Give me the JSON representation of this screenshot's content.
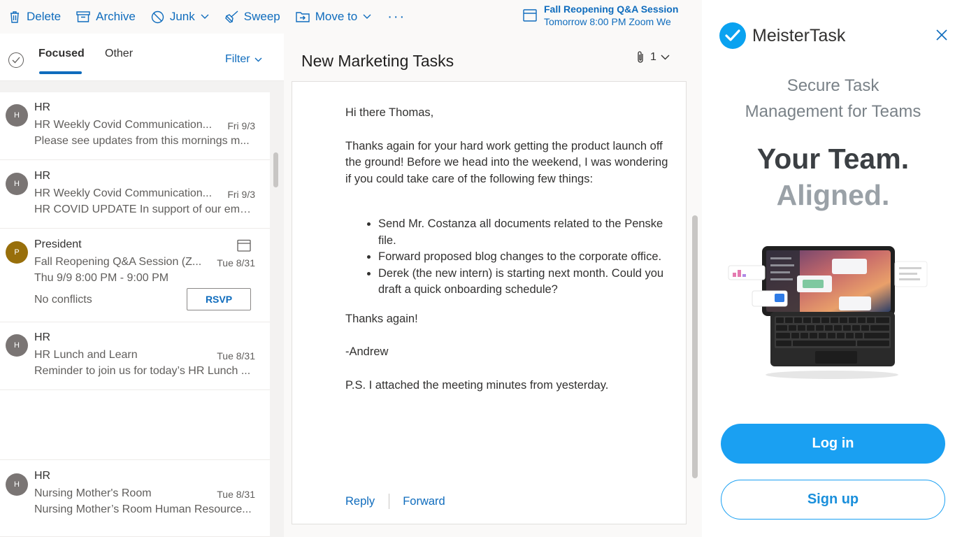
{
  "toolbar": {
    "delete_label": "Delete",
    "archive_label": "Archive",
    "junk_label": "Junk",
    "sweep_label": "Sweep",
    "move_label": "Move to",
    "more_label": "···",
    "event": {
      "title": "Fall Reopening Q&A Session",
      "subtitle": "Tomorrow 8:00 PM Zoom We"
    }
  },
  "list_header": {
    "tabs": [
      {
        "label": "Focused",
        "active": true
      },
      {
        "label": "Other",
        "active": false
      }
    ],
    "filter_label": "Filter"
  },
  "messages": [
    {
      "initial": "H",
      "sender": "HR",
      "subject": "HR Weekly Covid Communication...",
      "date": "Fri 9/3",
      "preview": "Please see updates from this mornings m..."
    },
    {
      "initial": "H",
      "sender": "HR",
      "subject": "HR Weekly Covid Communication...",
      "date": "Fri 9/3",
      "preview": "HR COVID UPDATE In support of our emp..."
    },
    {
      "initial": "P",
      "sender": "President",
      "subject": "Fall Reopening Q&A Session (Z...",
      "date": "Tue 8/31",
      "time": "Thu 9/9 8:00 PM - 9:00 PM",
      "conflicts": "No conflicts",
      "rsvp_label": "RSVP"
    },
    {
      "initial": "H",
      "sender": "HR",
      "subject": "HR Lunch and Learn",
      "date": "Tue 8/31",
      "preview": "Reminder to join us for today’s HR Lunch ..."
    },
    {
      "initial": "H",
      "sender": "HR",
      "subject": "Nursing Mother's Room",
      "date": "Tue 8/31",
      "preview": "Nursing Mother’s Room Human Resource..."
    }
  ],
  "reading": {
    "title": "New Marketing Tasks",
    "attachment_count": "1",
    "greeting": "Hi there Thomas,",
    "paragraph": "Thanks again for your hard work getting the product launch off the ground! Before we head into the weekend, I was wondering if you could take care of the following few things:",
    "bullets": [
      "Send Mr. Costanza all documents related to the Penske file.",
      "Forward proposed blog changes to the corporate office.",
      "Derek (the new intern) is starting next month. Could you draft a quick onboarding schedule?"
    ],
    "thanks": "Thanks again!",
    "signature": "-Andrew",
    "ps": "P.S. I attached the meeting minutes from yesterday.",
    "reply_label": "Reply",
    "forward_label": "Forward"
  },
  "addin": {
    "brand": "MeisterTask",
    "heading_line1": "Secure Task",
    "heading_line2": "Management for Teams",
    "hero_line1": "Your Team.",
    "hero_line2": "Aligned.",
    "login_label": "Log in",
    "signup_label": "Sign up",
    "accent_color": "#1aa0f2"
  }
}
